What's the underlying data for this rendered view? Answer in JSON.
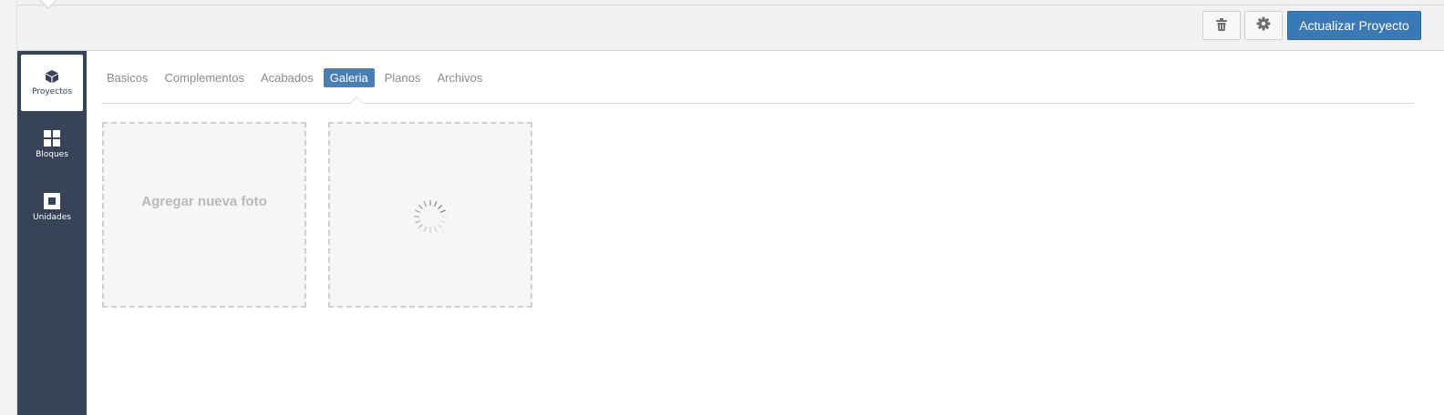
{
  "header": {
    "trash_icon": "trash-icon",
    "settings_icon": "gear-icon",
    "update_button_label": "Actualizar Proyecto",
    "accent_color": "#3a79b5"
  },
  "sidebar": {
    "background_color": "#374357",
    "items": [
      {
        "label": "Proyectos",
        "icon": "cube-icon",
        "active": true
      },
      {
        "label": "Bloques",
        "icon": "grid-icon",
        "active": false
      },
      {
        "label": "Unidades",
        "icon": "square-icon",
        "active": false
      }
    ]
  },
  "tabs": [
    {
      "label": "Basicos",
      "active": false
    },
    {
      "label": "Complementos",
      "active": false
    },
    {
      "label": "Acabados",
      "active": false
    },
    {
      "label": "Galeria",
      "active": true
    },
    {
      "label": "Planos",
      "active": false
    },
    {
      "label": "Archivos",
      "active": false
    }
  ],
  "gallery": {
    "add_photo_label": "Agregar nueva foto",
    "loading_icon": "spinner-icon"
  }
}
